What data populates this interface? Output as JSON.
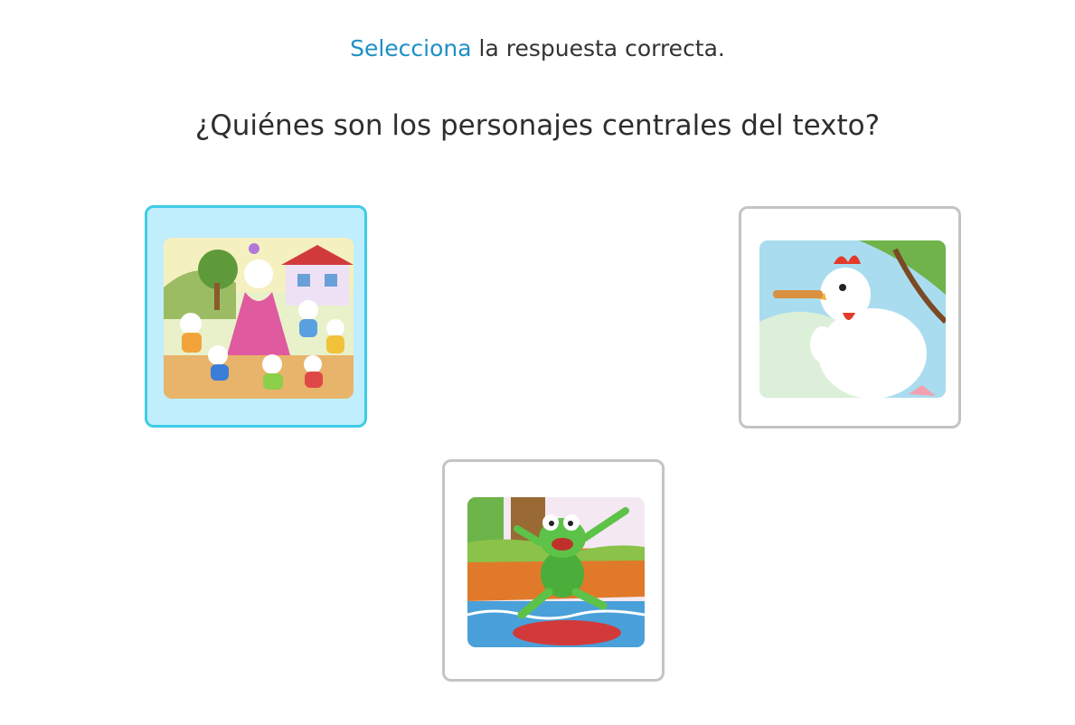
{
  "instruction": {
    "highlight": "Selecciona",
    "rest": " la respuesta correcta."
  },
  "question": "¿Quiénes son los personajes centrales del texto?",
  "options": [
    {
      "image": "illustration of a goat dancing with little goats",
      "selected": true
    },
    {
      "image": "illustration of a hen playing a flute",
      "selected": false
    },
    {
      "image": "illustration of a frog jumping from a lily pad",
      "selected": false
    }
  ],
  "colors": {
    "accent": "#1e8fc6",
    "selected_border": "#3fcce6",
    "selected_bg": "#c0eefc",
    "default_border": "#c4c4c4"
  }
}
